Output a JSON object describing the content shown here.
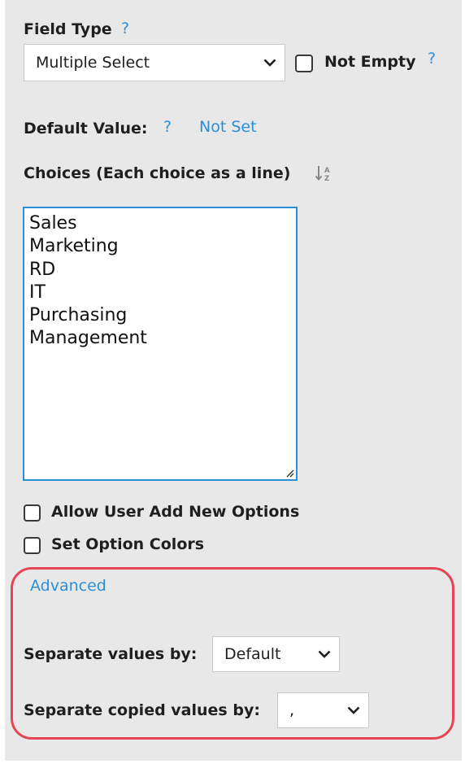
{
  "field_type": {
    "label": "Field Type",
    "help": "?",
    "selected": "Multiple Select",
    "not_empty_label": "Not Empty",
    "not_empty_help": "?",
    "not_empty_checked": false
  },
  "default_value": {
    "label": "Default Value:",
    "help": "?",
    "value_link": "Not Set"
  },
  "choices": {
    "label": "Choices (Each choice as a line)",
    "sort_icon": "sort-az-icon",
    "items": [
      "Sales",
      "Marketing",
      "RD",
      "IT",
      "Purchasing",
      "Management"
    ]
  },
  "options": {
    "allow_user_add_label": "Allow User Add New Options",
    "allow_user_add_checked": false,
    "set_colors_label": "Set Option Colors",
    "set_colors_checked": false
  },
  "advanced": {
    "link": "Advanced",
    "separate_values_label": "Separate values by:",
    "separate_values_selected": "Default",
    "separate_copied_label": "Separate copied values by:",
    "separate_copied_selected": ","
  },
  "colors": {
    "accent": "#2b8fd6",
    "highlight": "#e54553",
    "panel": "#e8e8e8"
  }
}
